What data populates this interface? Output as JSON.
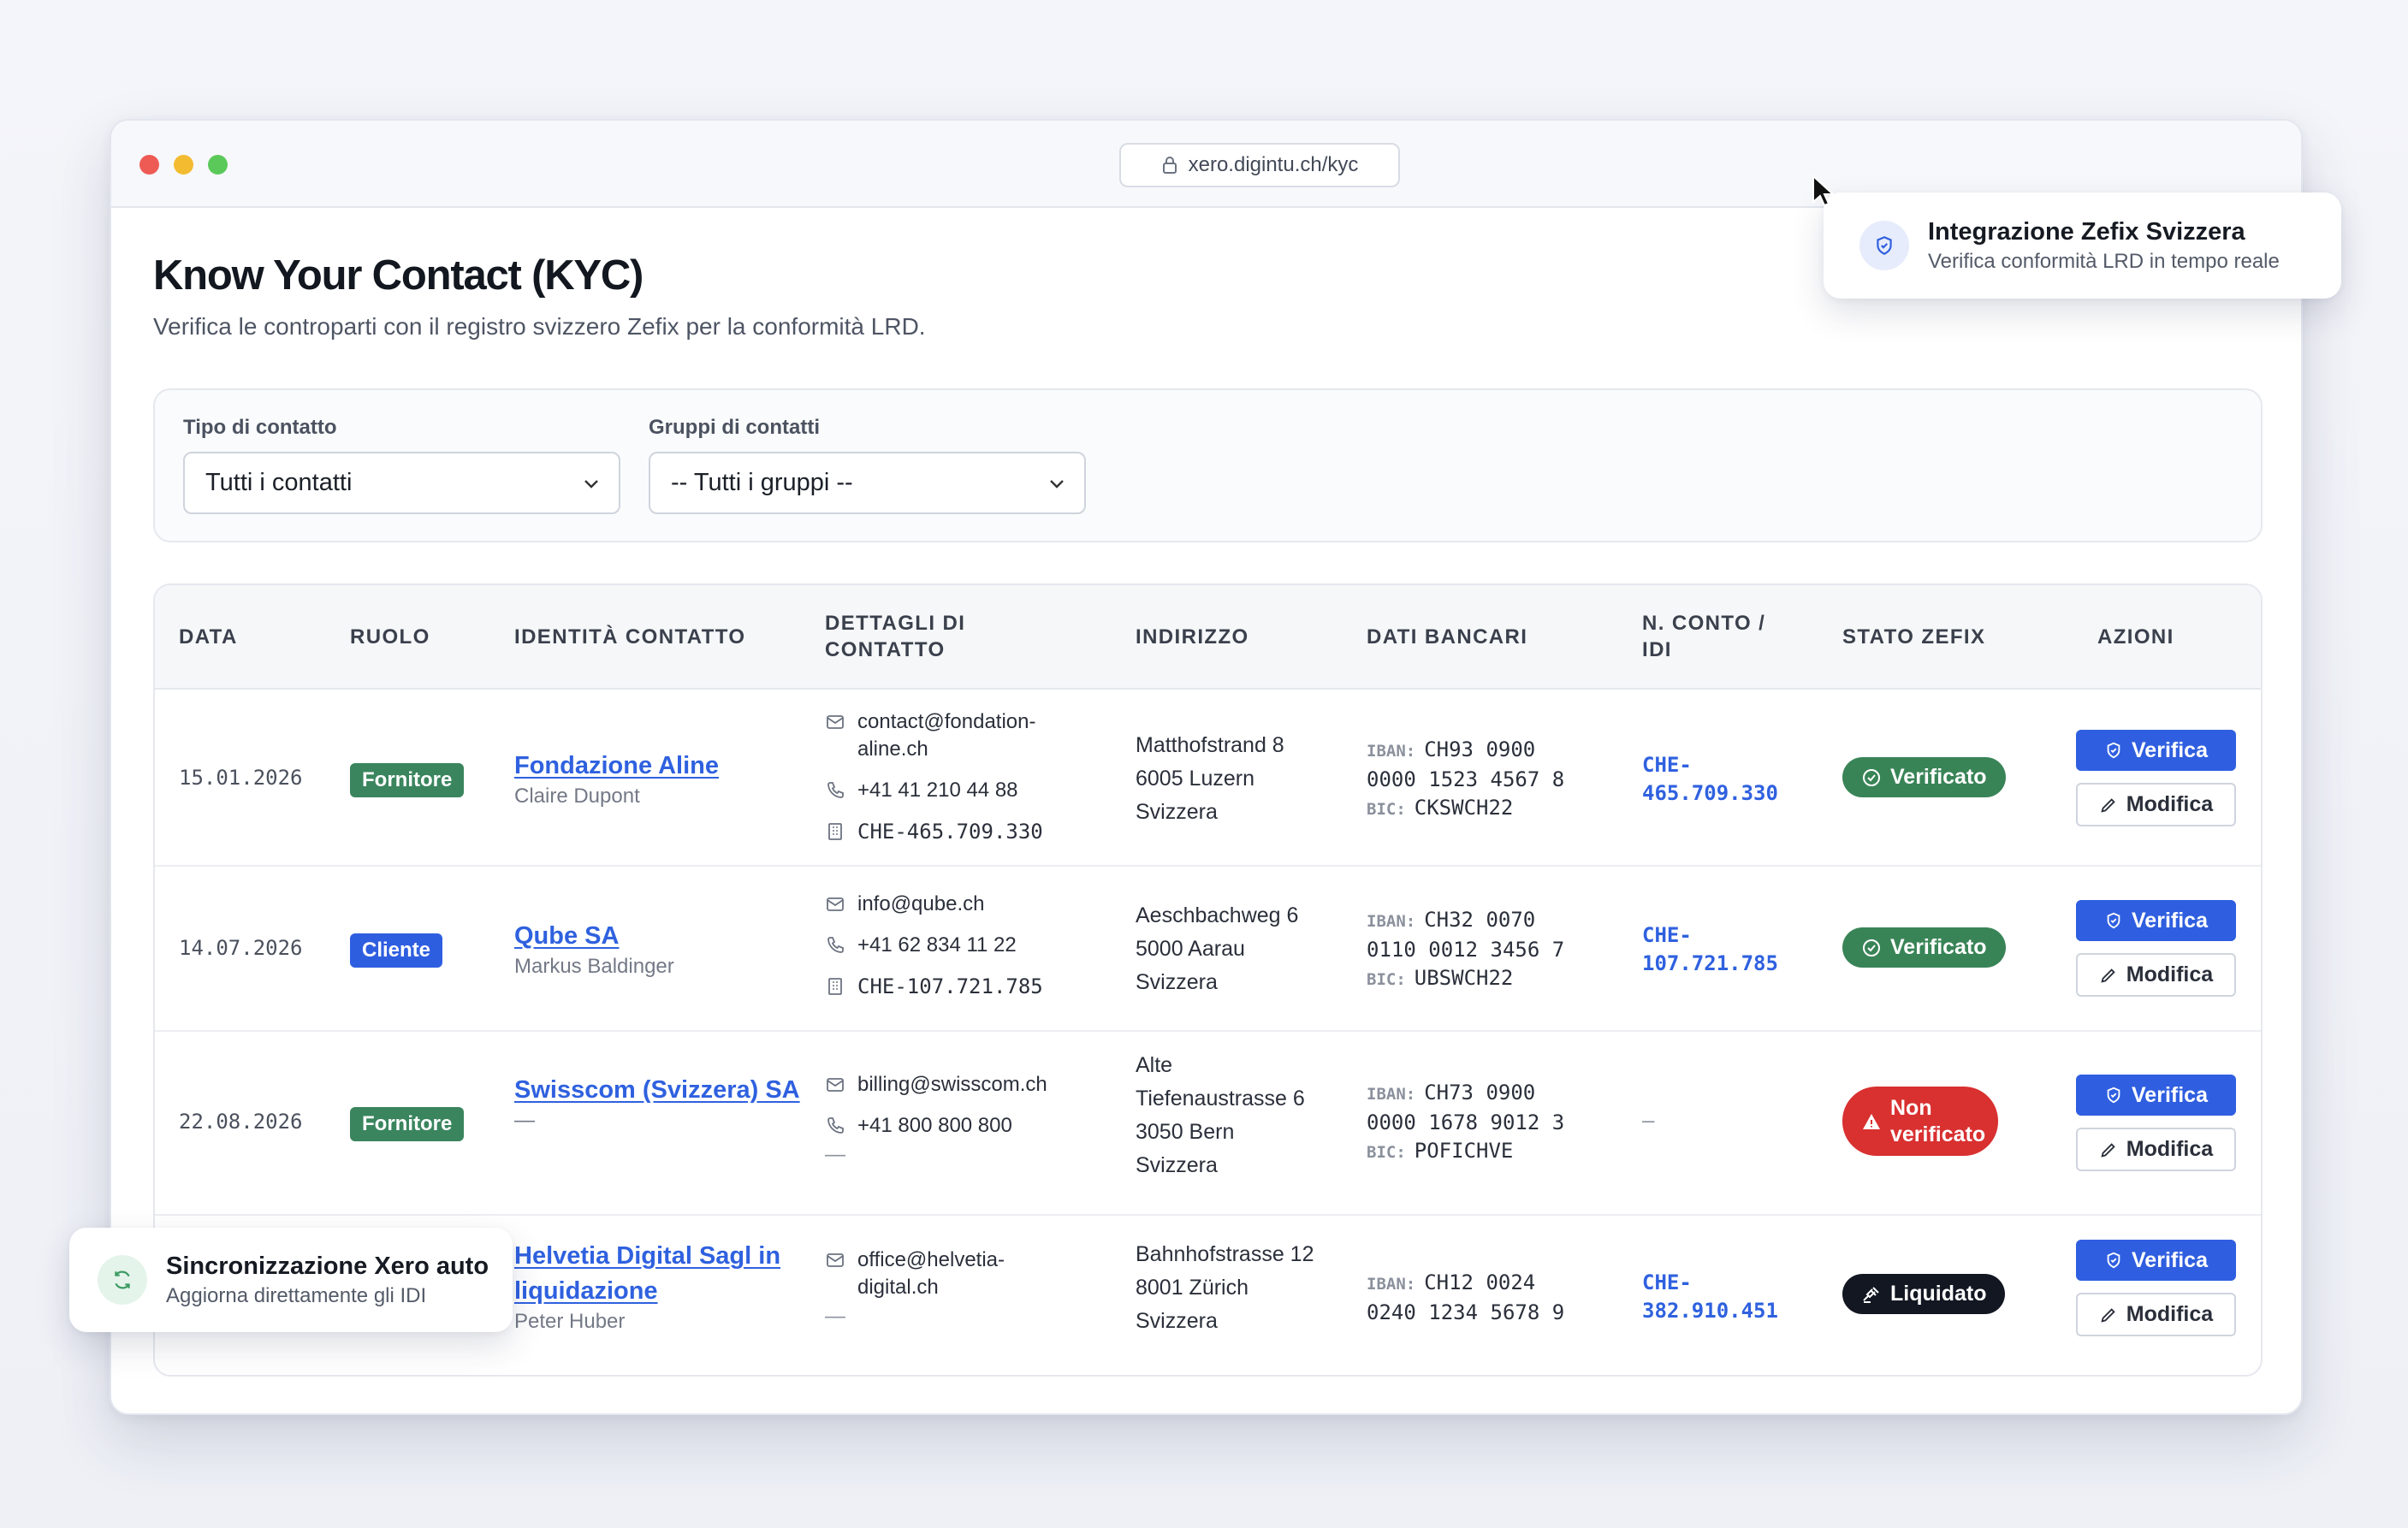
{
  "browser": {
    "url": "xero.digintu.ch/kyc"
  },
  "page": {
    "title": "Know Your Contact (KYC)",
    "subtitle": "Verifica le controparti con il registro svizzero Zefix per la conformità LRD."
  },
  "filters": {
    "type_label": "Tipo di contatto",
    "type_value": "Tutti i contatti",
    "group_label": "Gruppi di contatti",
    "group_value": "-- Tutti i gruppi --"
  },
  "table": {
    "headers": [
      "DATA",
      "RUOLO",
      "IDENTITÀ CONTATTO",
      "DETTAGLI DI CONTATTO",
      "INDIRIZZO",
      "DATI BANCARI",
      "N. CONTO / IDI",
      "STATO ZEFIX",
      "AZIONI"
    ],
    "iban_key": "IBAN:",
    "bic_key": "BIC:",
    "verify_label": "Verifica",
    "edit_label": "Modifica",
    "rows": [
      {
        "date": "15.01.2026",
        "role": "Fornitore",
        "name": "Fondazione Aline",
        "person": "Claire Dupont",
        "email": "contact@fondation-aline.ch",
        "phone": "+41 41 210 44 88",
        "uid": "CHE-465.709.330",
        "addr1": "Matthofstrand 8",
        "addr2": "6005 Luzern",
        "addr3": "Svizzera",
        "iban1": "CH93 0900",
        "iban2": "0000 1523 4567 8",
        "bic": "CKSWCH22",
        "idi": "CHE-465.709.330",
        "status": "Verificato"
      },
      {
        "date": "14.07.2026",
        "role": "Cliente",
        "name": "Qube SA",
        "person": "Markus Baldinger",
        "email": "info@qube.ch",
        "phone": "+41 62 834 11 22",
        "uid": "CHE-107.721.785",
        "addr1": "Aeschbachweg 6",
        "addr2": "5000 Aarau",
        "addr3": "Svizzera",
        "iban1": "CH32 0070",
        "iban2": "0110 0012 3456 7",
        "bic": "UBSWCH22",
        "idi": "CHE-107.721.785",
        "status": "Verificato"
      },
      {
        "date": "22.08.2026",
        "role": "Fornitore",
        "name": "Swisscom (Svizzera) SA",
        "person": "—",
        "email": "billing@swisscom.ch",
        "phone": "+41 800 800 800",
        "uid": "—",
        "addr1": "Alte",
        "addr2": "Tiefenaustrasse 6",
        "addr3": "3050 Bern",
        "addr4": "Svizzera",
        "iban1": "CH73 0900",
        "iban2": "0000 1678 9012 3",
        "bic": "POFICHVE",
        "idi": "—",
        "status": "Non verificato"
      },
      {
        "date": "",
        "role": "",
        "name": "Helvetia Digital Sagl in liquidazione",
        "person": "Peter Huber",
        "email": "office@helvetia-digital.ch",
        "phone": "—",
        "addr1": "Bahnhofstrasse 12",
        "addr2": "8001 Zürich",
        "addr3": "Svizzera",
        "iban1": "CH12 0024",
        "iban2": "0240 1234 5678 9",
        "idi": "CHE-382.910.451",
        "status": "Liquidato"
      }
    ]
  },
  "toast_zefix": {
    "title": "Integrazione Zefix Svizzera",
    "subtitle": "Verifica conformità LRD in tempo reale",
    "icon": "shield-check-icon"
  },
  "toast_xero": {
    "title": "Sincronizzazione Xero auto",
    "subtitle": "Aggiorna direttamente gli IDI",
    "icon": "refresh-icon"
  },
  "colors": {
    "accent": "#2f5fe0",
    "success": "#398457",
    "danger": "#d93030",
    "dark": "#121722"
  }
}
